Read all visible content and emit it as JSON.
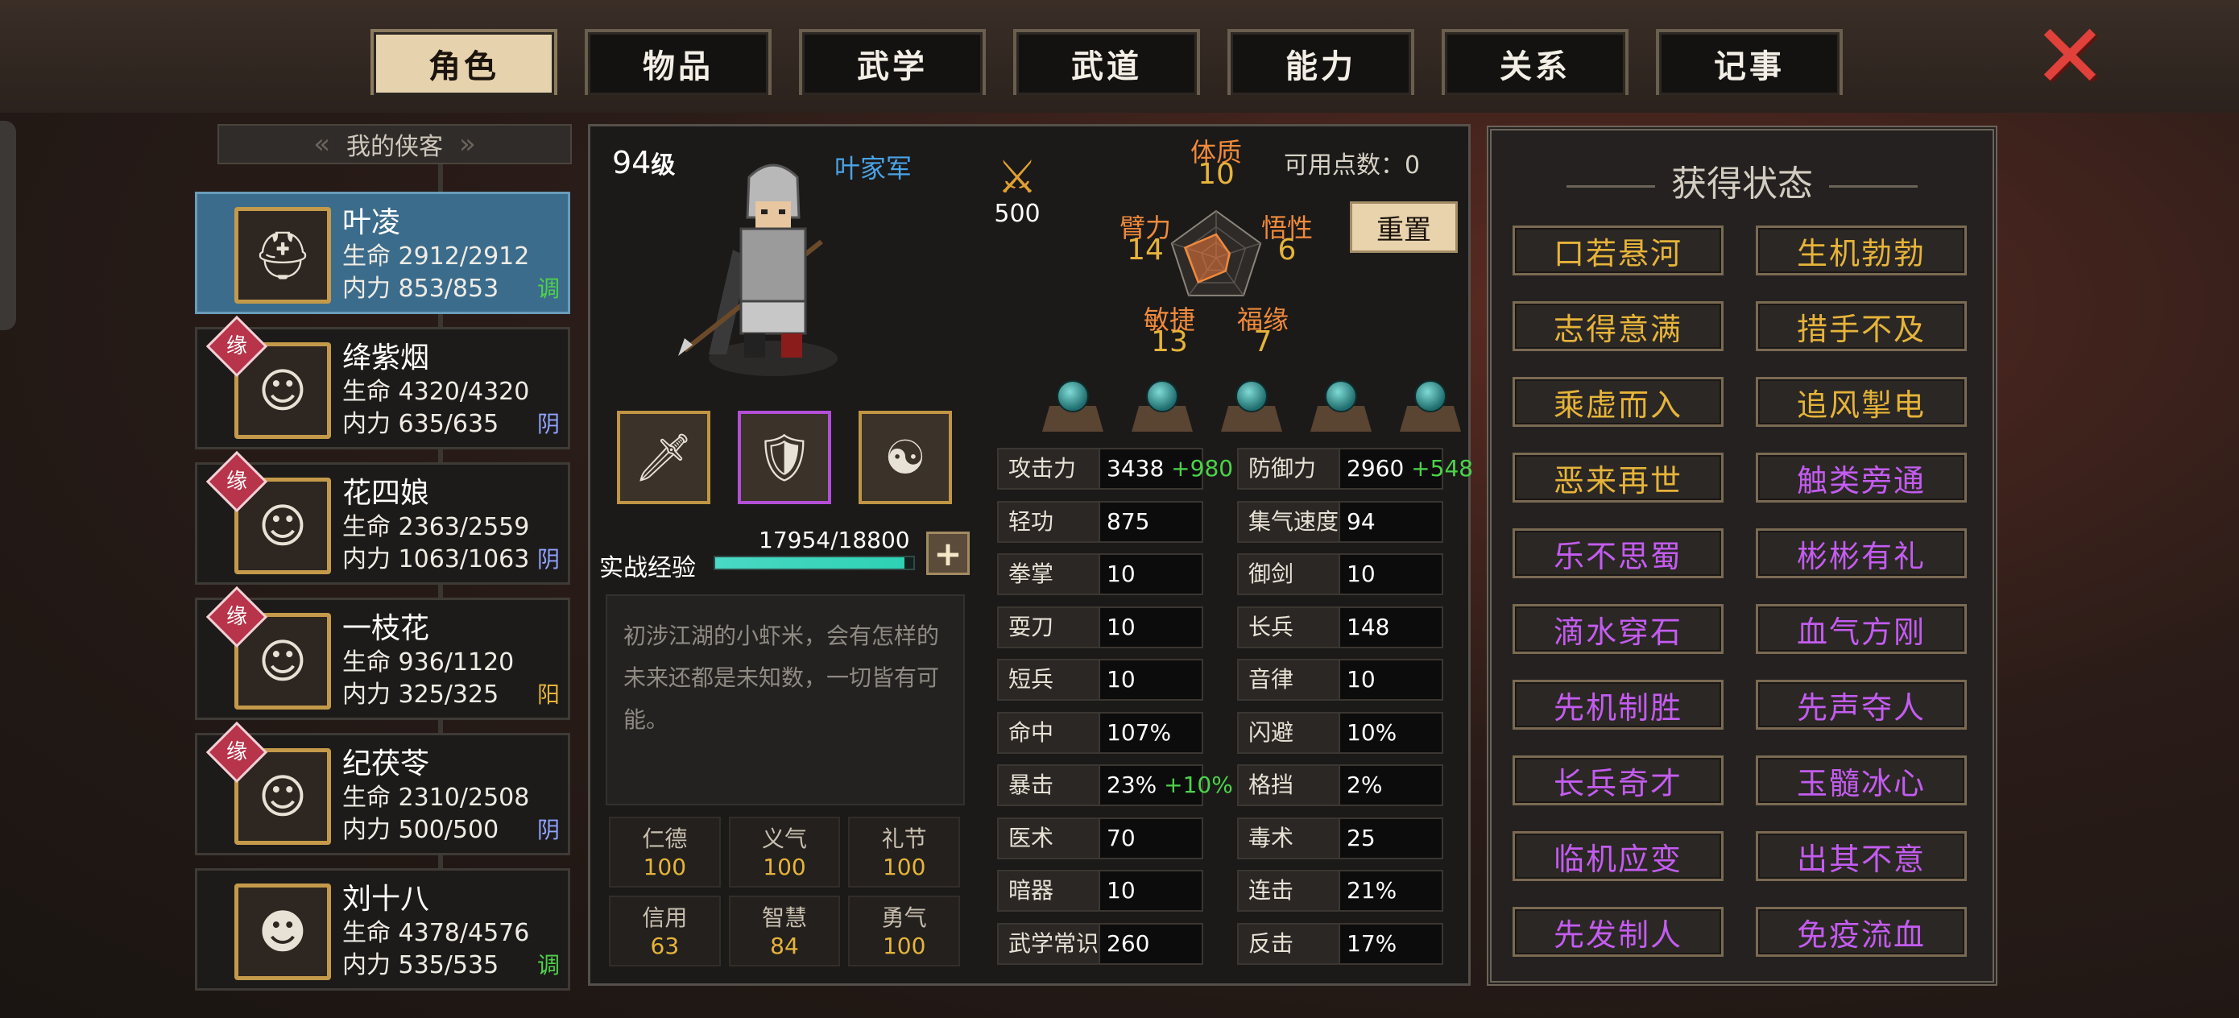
{
  "tabs": [
    {
      "label": "角色",
      "active": true
    },
    {
      "label": "物品",
      "active": false
    },
    {
      "label": "武学",
      "active": false
    },
    {
      "label": "武道",
      "active": false
    },
    {
      "label": "能力",
      "active": false
    },
    {
      "label": "关系",
      "active": false
    },
    {
      "label": "记事",
      "active": false
    }
  ],
  "roster": {
    "title": "我的侠客",
    "members": [
      {
        "name": "叶凌",
        "hp": "生命 2912/2912",
        "mp": "内力 853/853",
        "tag": "调",
        "tag_color": "#4fd14a",
        "fate": false,
        "active": true,
        "portrait_icon": "silver-helmet-warrior"
      },
      {
        "name": "绛紫烟",
        "hp": "生命 4320/4320",
        "mp": "内力 635/635",
        "tag": "阴",
        "tag_color": "#8fa3ff",
        "fate": true,
        "fate_label": "缘",
        "active": false,
        "portrait_icon": "purple-haired-woman"
      },
      {
        "name": "花四娘",
        "hp": "生命 2363/2559",
        "mp": "内力 1063/1063",
        "tag": "阴",
        "tag_color": "#8fa3ff",
        "fate": true,
        "fate_label": "缘",
        "active": false,
        "portrait_icon": "dark-haired-woman"
      },
      {
        "name": "一枝花",
        "hp": "生命 936/1120",
        "mp": "内力 325/325",
        "tag": "阳",
        "tag_color": "#e6b43a",
        "fate": true,
        "fate_label": "缘",
        "active": false,
        "portrait_icon": "woman-with-hair-ornament"
      },
      {
        "name": "纪茯苓",
        "hp": "生命 2310/2508",
        "mp": "内力 500/500",
        "tag": "阴",
        "tag_color": "#8fa3ff",
        "fate": true,
        "fate_label": "缘",
        "active": false,
        "portrait_icon": "young-woman"
      },
      {
        "name": "刘十八",
        "hp": "生命 4378/4576",
        "mp": "内力 535/535",
        "tag": "调",
        "tag_color": "#4fd14a",
        "fate": false,
        "active": false,
        "portrait_icon": "tiger-hood-man"
      }
    ]
  },
  "character": {
    "level": "94",
    "level_suffix": "级",
    "faction": "叶家军",
    "attack_power": "500",
    "available_points_label": "可用点数：0",
    "reset_label": "重置",
    "attributes": {
      "physique": {
        "name": "体质",
        "value": "10"
      },
      "strength": {
        "name": "臂力",
        "value": "14"
      },
      "comprehension": {
        "name": "悟性",
        "value": "6"
      },
      "agility": {
        "name": "敏捷",
        "value": "13"
      },
      "fortune": {
        "name": "福缘",
        "value": "7"
      }
    },
    "exp_label": "实战经验",
    "exp_value": "17954/18800",
    "exp_fraction": 0.955,
    "description": "初涉江湖的小虾米，会有怎样的未来还都是未知数，一切皆有可能。",
    "virtues": [
      {
        "name": "仁德",
        "value": "100"
      },
      {
        "name": "义气",
        "value": "100"
      },
      {
        "name": "礼节",
        "value": "100"
      },
      {
        "name": "信用",
        "value": "63"
      },
      {
        "name": "智慧",
        "value": "84"
      },
      {
        "name": "勇气",
        "value": "100"
      }
    ],
    "equipment": [
      {
        "slot": "weapon",
        "icon": "spear-icon",
        "glyph": "🗡"
      },
      {
        "slot": "armor",
        "icon": "armor-icon",
        "glyph": "🛡"
      },
      {
        "slot": "accessory",
        "icon": "amulet-icon",
        "glyph": "☯"
      }
    ],
    "stats": [
      {
        "label": "攻击力",
        "value": "3438",
        "bonus": "+980"
      },
      {
        "label": "防御力",
        "value": "2960",
        "bonus": "+548"
      },
      {
        "label": "轻功",
        "value": "875",
        "bonus": ""
      },
      {
        "label": "集气速度",
        "value": "94",
        "bonus": ""
      },
      {
        "label": "拳掌",
        "value": "10",
        "bonus": ""
      },
      {
        "label": "御剑",
        "value": "10",
        "bonus": ""
      },
      {
        "label": "耍刀",
        "value": "10",
        "bonus": ""
      },
      {
        "label": "长兵",
        "value": "148",
        "bonus": ""
      },
      {
        "label": "短兵",
        "value": "10",
        "bonus": ""
      },
      {
        "label": "音律",
        "value": "10",
        "bonus": ""
      },
      {
        "label": "命中",
        "value": "107%",
        "bonus": ""
      },
      {
        "label": "闪避",
        "value": "10%",
        "bonus": ""
      },
      {
        "label": "暴击",
        "value": "23%",
        "bonus": "+10%"
      },
      {
        "label": "格挡",
        "value": "2%",
        "bonus": ""
      },
      {
        "label": "医术",
        "value": "70",
        "bonus": ""
      },
      {
        "label": "毒术",
        "value": "25",
        "bonus": ""
      },
      {
        "label": "暗器",
        "value": "10",
        "bonus": ""
      },
      {
        "label": "连击",
        "value": "21%",
        "bonus": ""
      },
      {
        "label": "武学常识",
        "value": "260",
        "bonus": ""
      },
      {
        "label": "反击",
        "value": "17%",
        "bonus": ""
      }
    ]
  },
  "status_panel": {
    "title": "获得状态",
    "colors": {
      "gold": "#e6b43a",
      "purple": "#c35cf0"
    },
    "items": [
      {
        "label": "口若悬河",
        "tier": "gold"
      },
      {
        "label": "生机勃勃",
        "tier": "gold"
      },
      {
        "label": "志得意满",
        "tier": "gold"
      },
      {
        "label": "措手不及",
        "tier": "gold"
      },
      {
        "label": "乘虚而入",
        "tier": "gold"
      },
      {
        "label": "追风掣电",
        "tier": "gold"
      },
      {
        "label": "恶来再世",
        "tier": "gold"
      },
      {
        "label": "触类旁通",
        "tier": "purple"
      },
      {
        "label": "乐不思蜀",
        "tier": "purple"
      },
      {
        "label": "彬彬有礼",
        "tier": "purple"
      },
      {
        "label": "滴水穿石",
        "tier": "purple"
      },
      {
        "label": "血气方刚",
        "tier": "purple"
      },
      {
        "label": "先机制胜",
        "tier": "purple"
      },
      {
        "label": "先声夺人",
        "tier": "purple"
      },
      {
        "label": "长兵奇才",
        "tier": "purple"
      },
      {
        "label": "玉髓冰心",
        "tier": "purple"
      },
      {
        "label": "临机应变",
        "tier": "purple"
      },
      {
        "label": "出其不意",
        "tier": "purple"
      },
      {
        "label": "先发制人",
        "tier": "purple"
      },
      {
        "label": "免疫流血",
        "tier": "purple"
      }
    ]
  },
  "accent_colors": {
    "attribute_label": "#f08a3c",
    "attribute_value": "#e6b43a",
    "faction": "#4aa3e6",
    "bonus": "#4cd34a"
  }
}
